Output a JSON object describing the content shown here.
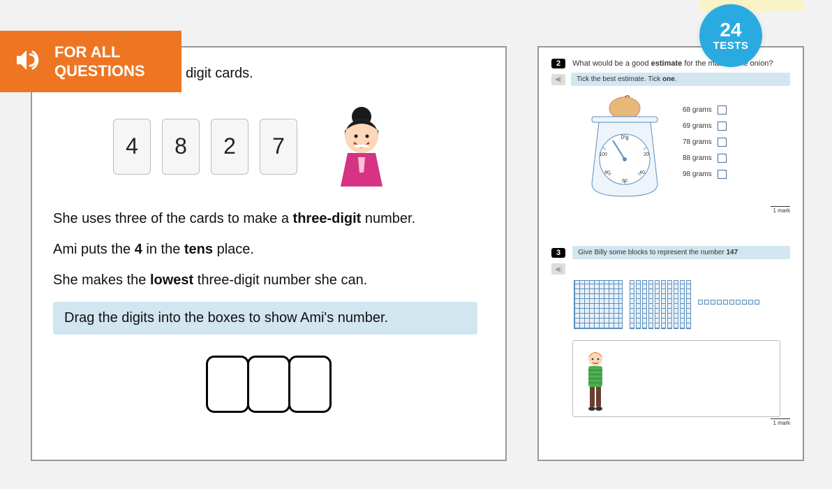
{
  "banner": {
    "line1": "FOR ALL",
    "line2": "QUESTIONS"
  },
  "tests_badge": {
    "count": "24",
    "label": "TESTS"
  },
  "main_question": {
    "intro": "digit cards.",
    "digits": [
      "4",
      "8",
      "2",
      "7"
    ],
    "para1_a": "She uses three of the cards to make a ",
    "para1_b": "three-digit",
    "para1_c": " number.",
    "para2_a": "Ami puts the ",
    "para2_b": "4",
    "para2_c": " in the ",
    "para2_d": "tens",
    "para2_e": " place.",
    "para3_a": "She makes the ",
    "para3_b": "lowest",
    "para3_c": " three-digit number she can.",
    "instruction": "Drag the digits into the boxes to show Ami's number."
  },
  "side": {
    "q2": {
      "num": "2",
      "text_a": "What would be a good ",
      "text_b": "estimate",
      "text_c": " for the mass of the onion?",
      "hint_a": "Tick the best estimate. Tick ",
      "hint_b": "one",
      "hint_c": ".",
      "scale": {
        "center": "0 g",
        "ticks": [
          "100",
          "20",
          "80",
          "40",
          "60"
        ]
      },
      "options": [
        "68 grams",
        "69 grams",
        "78 grams",
        "88 grams",
        "98 grams"
      ],
      "mark": "1 mark"
    },
    "q3": {
      "num": "3",
      "text_a": "Give Billy some blocks to represent the number ",
      "text_b": "147",
      "mark": "1 mark"
    }
  }
}
